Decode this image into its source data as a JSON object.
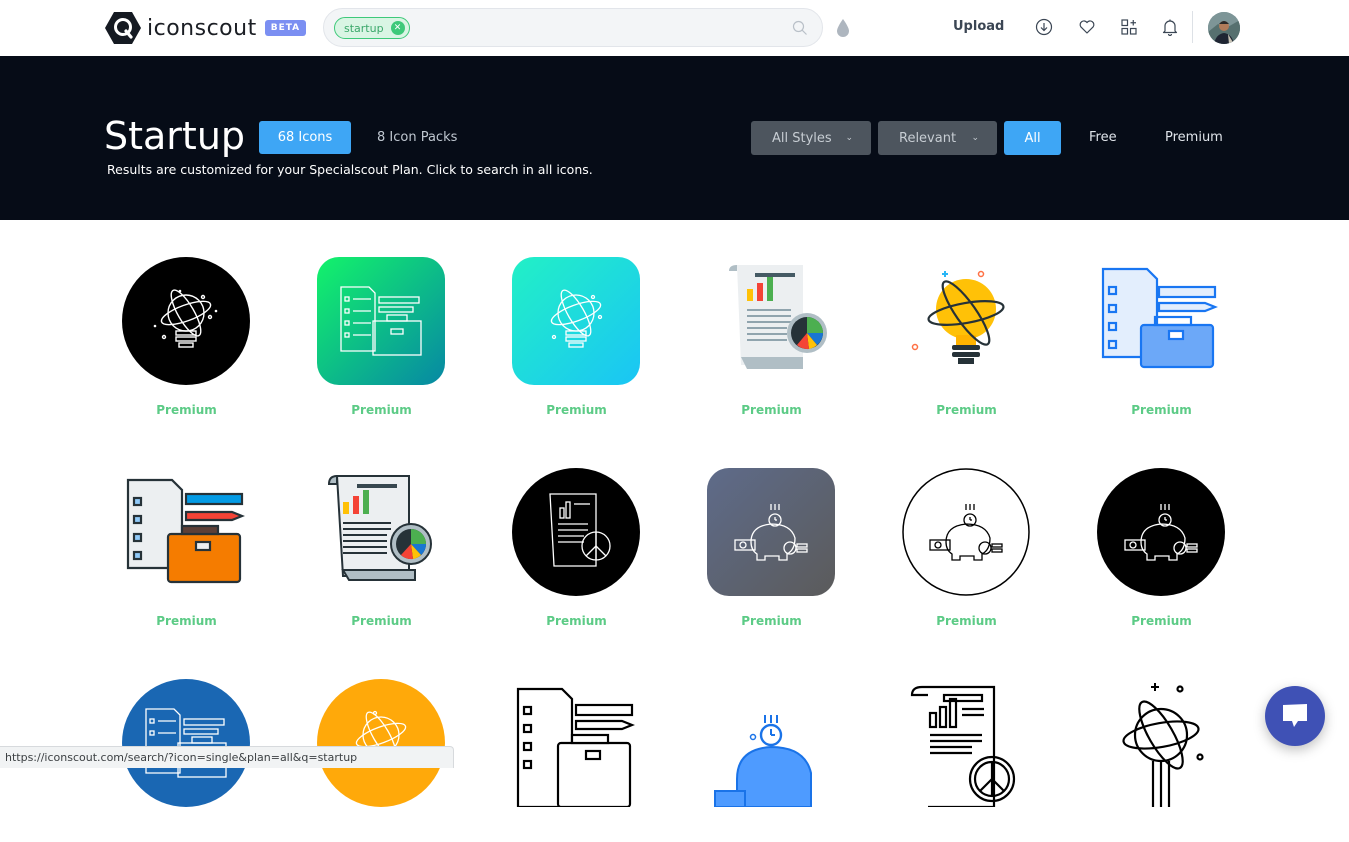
{
  "header": {
    "brand": "iconscout",
    "badge": "BETA",
    "search": {
      "chip": "startup",
      "placeholder": ""
    },
    "upload_label": "Upload",
    "icons": [
      "search-icon",
      "color-drop-icon",
      "download-icon",
      "heart-icon",
      "collections-icon",
      "bell-icon"
    ]
  },
  "hero": {
    "title": "Startup",
    "tabs": [
      {
        "label": "68 Icons",
        "active": true
      },
      {
        "label": "8 Icon Packs",
        "active": false
      }
    ],
    "note": "Results are customized for your Specialscout Plan. Click to search in all icons.",
    "style_dropdown": "All Styles",
    "sort_dropdown": "Relevant",
    "filters": [
      {
        "label": "All",
        "active": true
      },
      {
        "label": "Free",
        "active": false
      },
      {
        "label": "Premium",
        "active": false
      }
    ]
  },
  "results": [
    {
      "label": "Premium",
      "subject": "lightbulb-atom",
      "style": "white-line-on-black-circle"
    },
    {
      "label": "Premium",
      "subject": "checklist-briefcase",
      "style": "white-line-on-green-gradient-square"
    },
    {
      "label": "Premium",
      "subject": "lightbulb-atom",
      "style": "white-line-on-cyan-gradient-square"
    },
    {
      "label": "Premium",
      "subject": "report-pie-chart",
      "style": "flat-color"
    },
    {
      "label": "Premium",
      "subject": "lightbulb-atom",
      "style": "flat-color"
    },
    {
      "label": "Premium",
      "subject": "checklist-briefcase",
      "style": "blue-line"
    },
    {
      "label": "Premium",
      "subject": "checklist-briefcase",
      "style": "filled-outline"
    },
    {
      "label": "Premium",
      "subject": "report-pie-chart",
      "style": "filled-outline"
    },
    {
      "label": "Premium",
      "subject": "report-pie-chart",
      "style": "white-line-on-black-circle"
    },
    {
      "label": "Premium",
      "subject": "piggy-bank-savings",
      "style": "white-line-on-gray-gradient-square"
    },
    {
      "label": "Premium",
      "subject": "piggy-bank-savings",
      "style": "black-line-on-white-circle"
    },
    {
      "label": "Premium",
      "subject": "piggy-bank-savings",
      "style": "white-line-on-black-circle"
    },
    {
      "label": "",
      "subject": "checklist-briefcase",
      "style": "white-line-on-blue-circle"
    },
    {
      "label": "",
      "subject": "lightbulb-atom",
      "style": "white-line-on-orange-circle"
    },
    {
      "label": "",
      "subject": "checklist-briefcase",
      "style": "black-line"
    },
    {
      "label": "",
      "subject": "piggy-bank-savings",
      "style": "blue-glyph"
    },
    {
      "label": "",
      "subject": "report-pie-chart",
      "style": "black-line"
    },
    {
      "label": "",
      "subject": "lightbulb-atom",
      "style": "black-line"
    }
  ],
  "status_bar": "https://iconscout.com/search/?icon=single&plan=all&q=startup",
  "colors": {
    "accent": "#3ea6f5",
    "premium": "#5ccb86",
    "hero_bg": "#060c17",
    "chat": "#3f51b5"
  }
}
